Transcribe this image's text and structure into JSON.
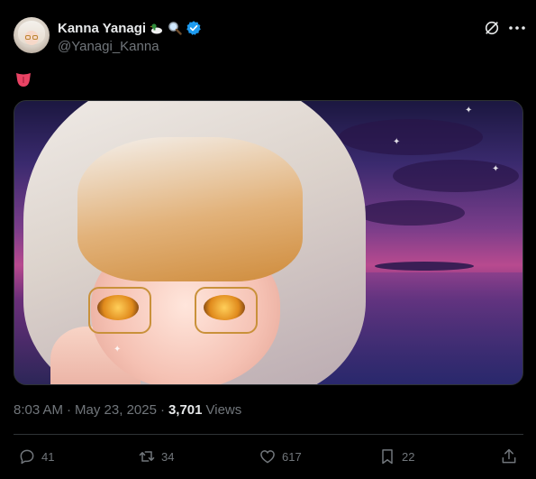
{
  "tweet": {
    "display_name": "Kanna Yanagi",
    "name_emojis": [
      "duck-icon",
      "magnifier-icon"
    ],
    "handle": "@Yanagi_Kanna",
    "text_emoji": "tongue-icon",
    "time": "8:03 AM",
    "separator": "·",
    "date": "May 23, 2025",
    "views_count": "3,701",
    "views_label": "Views"
  },
  "actions": {
    "replies": "41",
    "reposts": "34",
    "likes": "617",
    "bookmarks": "22"
  },
  "colors": {
    "background": "#000000",
    "primary_text": "#e7e9ea",
    "secondary_text": "#71767b",
    "verified": "#1d9bf0",
    "divider": "#2f3336"
  }
}
